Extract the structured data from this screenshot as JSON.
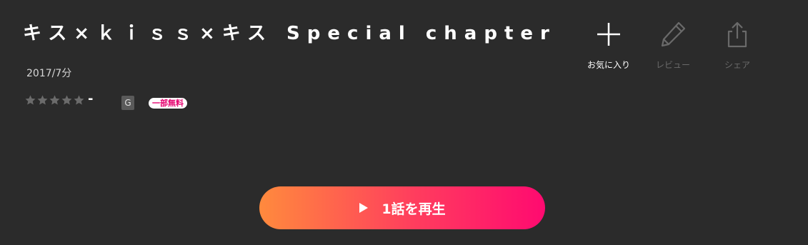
{
  "title": "キス×ｋｉｓｓ×キス Special chapter",
  "meta": "2017/7分",
  "rating": {
    "stars_filled": 0,
    "stars_total": 5,
    "score": "-",
    "age_rating": "G",
    "free_badge": "一部無料"
  },
  "actions": {
    "favorite_label": "お気に入り",
    "review_label": "レビュー",
    "share_label": "シェア"
  },
  "play_button": {
    "label": "1話を再生"
  },
  "colors": {
    "background": "#2b2b2b",
    "star_empty": "#6b6b6b",
    "free_badge_text": "#e5006e",
    "play_gradient_start": "#ff8a3d",
    "play_gradient_end": "#ff0a70",
    "disabled_action": "#6a6a6a"
  }
}
